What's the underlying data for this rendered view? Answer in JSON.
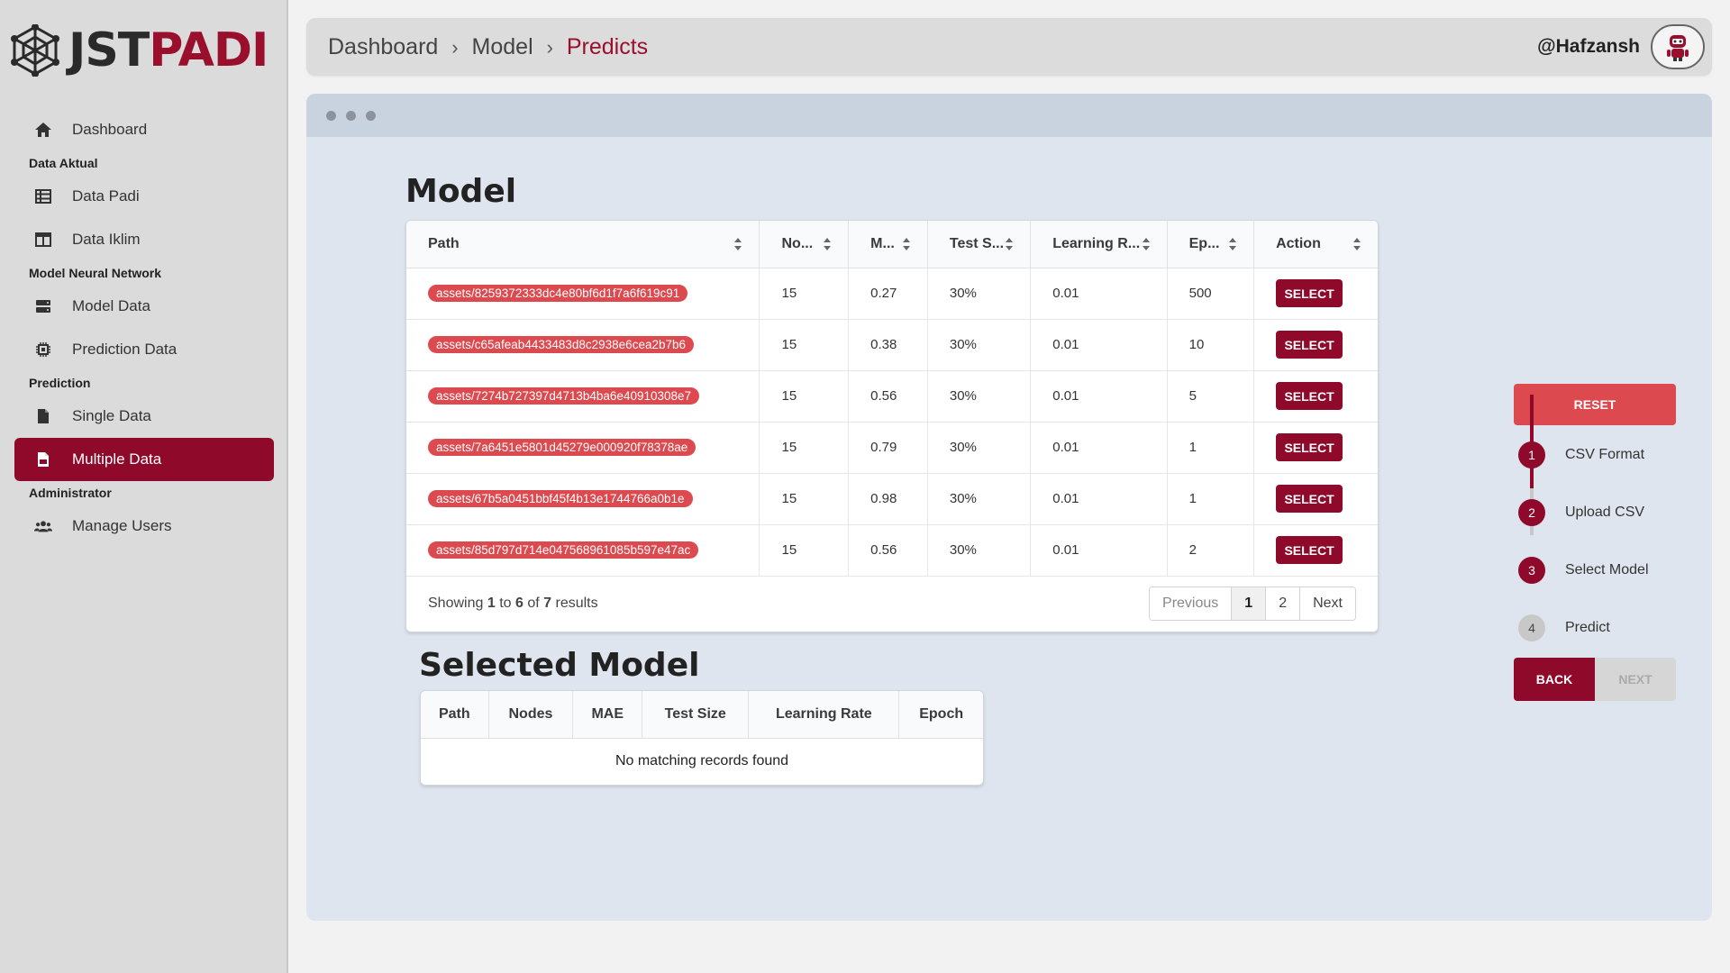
{
  "brand": {
    "jst": "JST",
    "padi": "PADI"
  },
  "sidebar": {
    "items": [
      {
        "type": "item",
        "label": "Dashboard",
        "icon": "home-icon",
        "name": "sidebar-item-dashboard"
      },
      {
        "type": "section",
        "label": "Data Aktual"
      },
      {
        "type": "item",
        "label": "Data Padi",
        "icon": "table-icon",
        "name": "sidebar-item-data-padi"
      },
      {
        "type": "item",
        "label": "Data Iklim",
        "icon": "columns-icon",
        "name": "sidebar-item-data-iklim"
      },
      {
        "type": "section",
        "label": "Model Neural Network"
      },
      {
        "type": "item",
        "label": "Model Data",
        "icon": "server-icon",
        "name": "sidebar-item-model-data"
      },
      {
        "type": "item",
        "label": "Prediction Data",
        "icon": "chip-icon",
        "name": "sidebar-item-prediction-data"
      },
      {
        "type": "section",
        "label": "Prediction"
      },
      {
        "type": "item",
        "label": "Single Data",
        "icon": "file-icon",
        "name": "sidebar-item-single-data"
      },
      {
        "type": "item",
        "label": "Multiple Data",
        "icon": "csv-file-icon",
        "name": "sidebar-item-multiple-data",
        "active": true
      },
      {
        "type": "section",
        "label": "Administrator"
      },
      {
        "type": "item",
        "label": "Manage Users",
        "icon": "users-icon",
        "name": "sidebar-item-manage-users"
      }
    ]
  },
  "header": {
    "breadcrumb": [
      "Dashboard",
      "Model",
      "Predicts"
    ],
    "separator": "›",
    "username": "@Hafzansh"
  },
  "model_section": {
    "title": "Model",
    "columns": [
      "Path",
      "No...",
      "M...",
      "Test S...",
      "Learning R...",
      "Ep...",
      "Action"
    ],
    "rows": [
      {
        "path": "assets/8259372333dc4e80bf6d1f7a6f619c91",
        "nodes": "15",
        "mae": "0.27",
        "test_size": "30%",
        "learning_rate": "0.01",
        "epoch": "500"
      },
      {
        "path": "assets/c65afeab4433483d8c2938e6cea2b7b6",
        "nodes": "15",
        "mae": "0.38",
        "test_size": "30%",
        "learning_rate": "0.01",
        "epoch": "10"
      },
      {
        "path": "assets/7274b727397d4713b4ba6e40910308e7",
        "nodes": "15",
        "mae": "0.56",
        "test_size": "30%",
        "learning_rate": "0.01",
        "epoch": "5"
      },
      {
        "path": "assets/7a6451e5801d45279e000920f78378ae",
        "nodes": "15",
        "mae": "0.79",
        "test_size": "30%",
        "learning_rate": "0.01",
        "epoch": "1"
      },
      {
        "path": "assets/67b5a0451bbf45f4b13e1744766a0b1e",
        "nodes": "15",
        "mae": "0.98",
        "test_size": "30%",
        "learning_rate": "0.01",
        "epoch": "1"
      },
      {
        "path": "assets/85d797d714e047568961085b597e47ac",
        "nodes": "15",
        "mae": "0.56",
        "test_size": "30%",
        "learning_rate": "0.01",
        "epoch": "2"
      }
    ],
    "select_label": "SELECT",
    "footer": {
      "showing": "Showing",
      "from": "1",
      "to_word": "to",
      "to": "6",
      "of_word": "of",
      "total": "7",
      "results": "results"
    },
    "pagination": {
      "previous": "Previous",
      "pages": [
        "1",
        "2"
      ],
      "current": "1",
      "next": "Next"
    }
  },
  "selected_section": {
    "title": "Selected Model",
    "columns": [
      "Path",
      "Nodes",
      "MAE",
      "Test Size",
      "Learning Rate",
      "Epoch"
    ],
    "empty_message": "No matching records found"
  },
  "stepper": {
    "reset_label": "RESET",
    "steps": [
      {
        "num": "1",
        "label": "CSV Format",
        "state": "done"
      },
      {
        "num": "2",
        "label": "Upload CSV",
        "state": "done"
      },
      {
        "num": "3",
        "label": "Select Model",
        "state": "done"
      },
      {
        "num": "4",
        "label": "Predict",
        "state": "todo"
      }
    ],
    "back_label": "BACK",
    "next_label": "NEXT"
  },
  "colors": {
    "brand": "#8f0a2a",
    "pill": "#dc4a4f",
    "sidebar_bg": "#dbdbdb",
    "panel_bg": "#dfe5ee"
  }
}
